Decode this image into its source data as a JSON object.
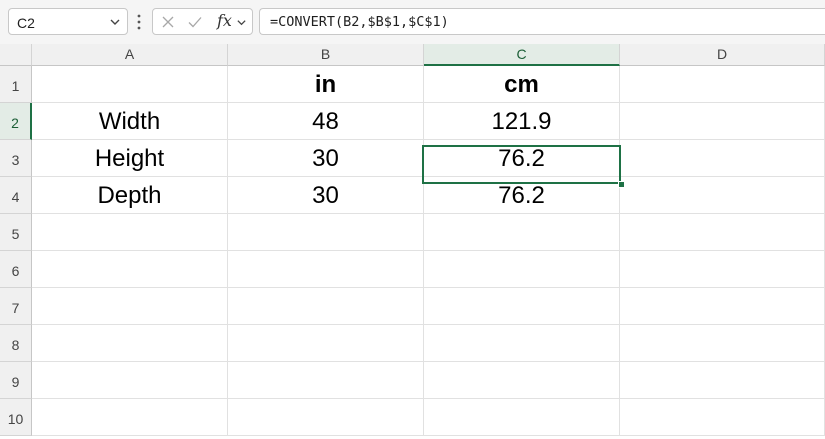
{
  "formula_bar": {
    "name_box": "C2",
    "fx_label": "fx",
    "formula": "=CONVERT(B2,$B$1,$C$1)",
    "icons": [
      "chevron-down-icon",
      "more-options-icon",
      "cancel-x-icon",
      "enter-check-icon",
      "insert-function-icon"
    ]
  },
  "columns": [
    "A",
    "B",
    "C",
    "D"
  ],
  "selected_column": "C",
  "rows": [
    "1",
    "2",
    "3",
    "4",
    "5",
    "6",
    "7",
    "8",
    "9",
    "10"
  ],
  "selected_row": "2",
  "cells": {
    "A1": "",
    "B1": "in",
    "C1": "cm",
    "A2": "Width",
    "B2": "48",
    "C2": "121.9",
    "A3": "Height",
    "B3": "30",
    "C3": "76.2",
    "A4": "Depth",
    "B4": "30",
    "C4": "76.2"
  },
  "colors": {
    "selection_accent": "#1e7145",
    "header_bg": "#f0f0f0",
    "selected_header_bg": "#e3ece6"
  }
}
